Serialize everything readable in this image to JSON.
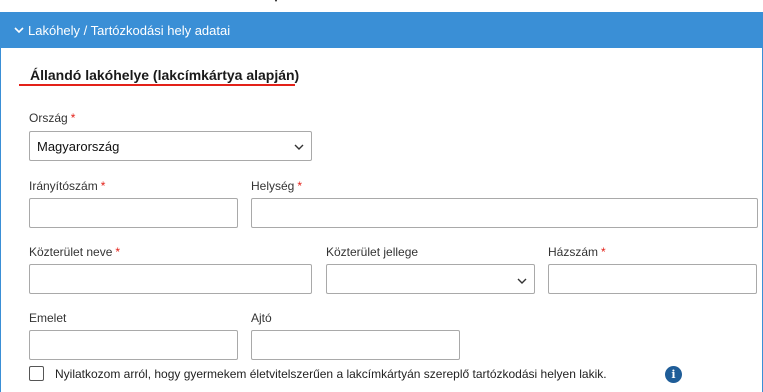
{
  "panel": {
    "header_title": "Lakóhely / Tartózkodási hely adatai",
    "header_icon": "chevron-down-icon",
    "accent_color": "#3a8fd6"
  },
  "section": {
    "title": "Állandó lakóhelye (lakcímkártya alapján)",
    "underline_color": "#e32119"
  },
  "form": {
    "required_marker": "*",
    "country": {
      "label": "Ország",
      "value": "Magyarország"
    },
    "zip": {
      "label": "Irányítószám",
      "value": ""
    },
    "city": {
      "label": "Helység",
      "value": ""
    },
    "street_name": {
      "label": "Közterület neve",
      "value": ""
    },
    "street_type": {
      "label": "Közterület jellege",
      "value": ""
    },
    "house_number": {
      "label": "Házszám",
      "value": ""
    },
    "floor": {
      "label": "Emelet",
      "value": ""
    },
    "door": {
      "label": "Ajtó",
      "value": ""
    }
  },
  "declaration": {
    "text": "Nyilatkozom arról, hogy gyermekem életvitelszerűen a lakcímkártyán szereplő tartózkodási helyen lakik.",
    "checked": false,
    "info_icon": "info-icon",
    "info_glyph": "i"
  }
}
